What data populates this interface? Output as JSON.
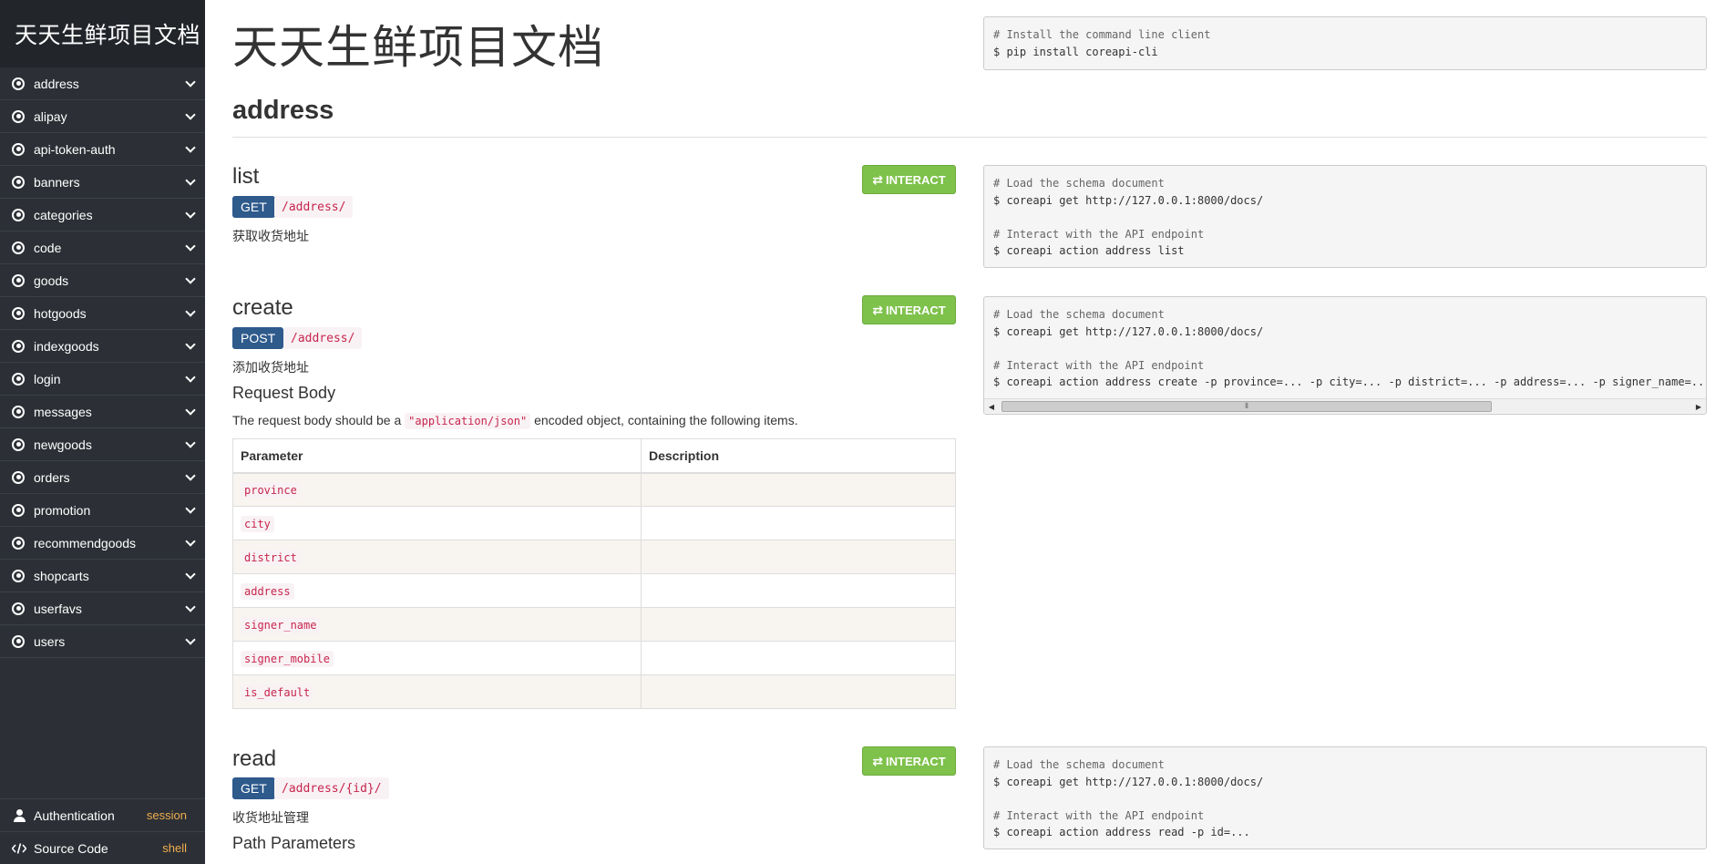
{
  "sidebar": {
    "brand": "天天生鲜项目文档",
    "items": [
      {
        "label": "address"
      },
      {
        "label": "alipay"
      },
      {
        "label": "api-token-auth"
      },
      {
        "label": "banners"
      },
      {
        "label": "categories"
      },
      {
        "label": "code"
      },
      {
        "label": "goods"
      },
      {
        "label": "hotgoods"
      },
      {
        "label": "indexgoods"
      },
      {
        "label": "login"
      },
      {
        "label": "messages"
      },
      {
        "label": "newgoods"
      },
      {
        "label": "orders"
      },
      {
        "label": "promotion"
      },
      {
        "label": "recommendgoods"
      },
      {
        "label": "shopcarts"
      },
      {
        "label": "userfavs"
      },
      {
        "label": "users"
      }
    ],
    "authentication": {
      "label": "Authentication",
      "value": "session"
    },
    "source_code": {
      "label": "Source Code",
      "value": "shell"
    }
  },
  "page": {
    "title": "天天生鲜项目文档",
    "section": "address",
    "interact_label": "INTERACT"
  },
  "install_code": [
    "# Install the command line client",
    "$ pip install coreapi-cli"
  ],
  "endpoints": {
    "list": {
      "name": "list",
      "method": "GET",
      "path": "/address/",
      "description": "获取收货地址",
      "code": [
        "# Load the schema document",
        "$ coreapi get http://127.0.0.1:8000/docs/",
        "",
        "# Interact with the API endpoint",
        "$ coreapi action address list"
      ]
    },
    "create": {
      "name": "create",
      "method": "POST",
      "path": "/address/",
      "description": "添加收货地址",
      "request_body_heading": "Request Body",
      "request_body_text_before": "The request body should be a ",
      "request_body_code": "\"application/json\"",
      "request_body_text_after": " encoded object, containing the following items.",
      "table_headers": [
        "Parameter",
        "Description"
      ],
      "parameters": [
        "province",
        "city",
        "district",
        "address",
        "signer_name",
        "signer_mobile",
        "is_default"
      ],
      "code": [
        "# Load the schema document",
        "$ coreapi get http://127.0.0.1:8000/docs/",
        "",
        "# Interact with the API endpoint",
        "$ coreapi action address create -p province=... -p city=... -p district=... -p address=... -p signer_name=... -p signer_mobile=... -p is_default=..."
      ]
    },
    "read": {
      "name": "read",
      "method": "GET",
      "path": "/address/{id}/",
      "description": "收货地址管理",
      "path_params_heading": "Path Parameters",
      "code": [
        "# Load the schema document",
        "$ coreapi get http://127.0.0.1:8000/docs/",
        "",
        "# Interact with the API endpoint",
        "$ coreapi action address read -p id=..."
      ]
    }
  }
}
